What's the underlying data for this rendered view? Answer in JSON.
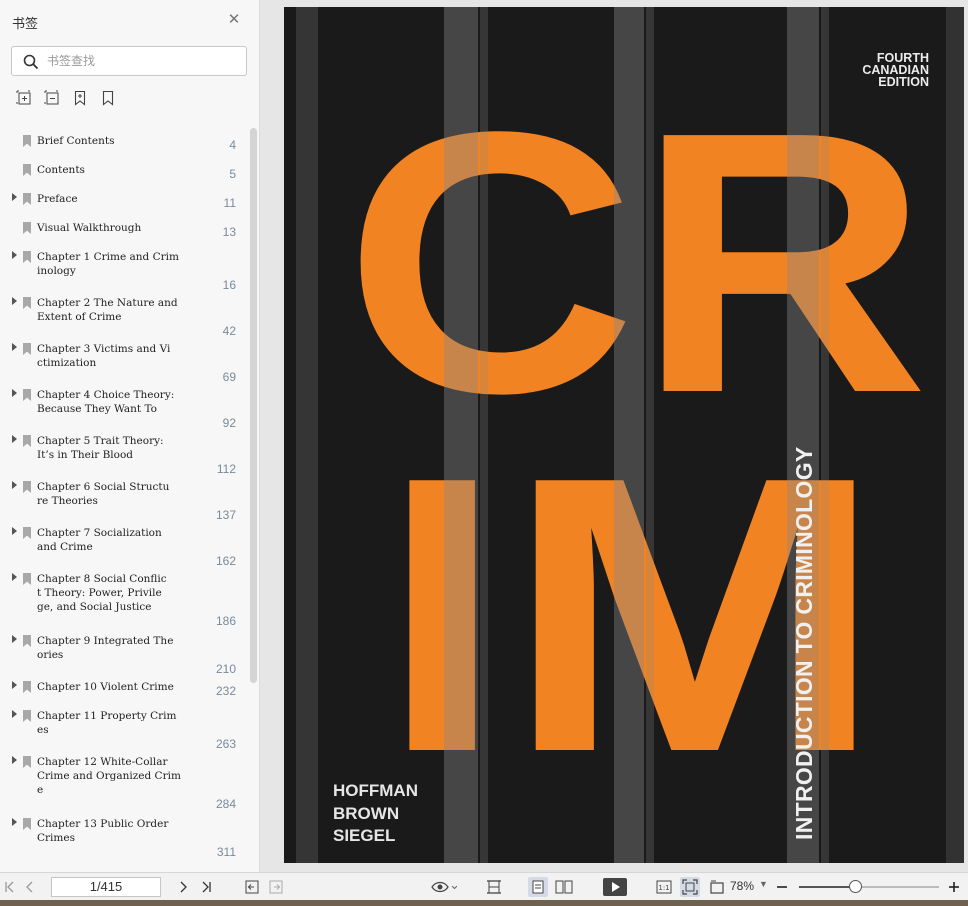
{
  "sidebar": {
    "title": "书签",
    "search_placeholder": "书签查找",
    "bookmarks": [
      {
        "label": "Brief Contents",
        "page": "4",
        "expandable": false
      },
      {
        "label": "Contents",
        "page": "5",
        "expandable": false
      },
      {
        "label": "Preface",
        "page": "11",
        "expandable": true
      },
      {
        "label": "Visual Walkthrough",
        "page": "13",
        "expandable": false
      },
      {
        "label": "Chapter 1 Crime and Crim\ninology",
        "page": "16",
        "expandable": true
      },
      {
        "label": "Chapter 2 The Nature and\nExtent of Crime",
        "page": "42",
        "expandable": true
      },
      {
        "label": "Chapter 3 Victims and Vi\nctimization",
        "page": "69",
        "expandable": true
      },
      {
        "label": "Chapter 4 Choice Theory:\nBecause They Want To",
        "page": "92",
        "expandable": true
      },
      {
        "label": "Chapter 5 Trait Theory:\nIt’s in Their Blood",
        "page": "112",
        "expandable": true
      },
      {
        "label": "Chapter 6 Social Structu\nre Theories",
        "page": "137",
        "expandable": true
      },
      {
        "label": "Chapter 7 Socialization\nand Crime",
        "page": "162",
        "expandable": true
      },
      {
        "label": "Chapter 8 Social Conflic\nt Theory: Power, Privile\nge, and Social Justice",
        "page": "186",
        "expandable": true
      },
      {
        "label": "Chapter 9 Integrated The\nories",
        "page": "210",
        "expandable": true
      },
      {
        "label": "Chapter 10 Violent Crime",
        "page": "232",
        "expandable": true
      },
      {
        "label": "Chapter 11 Property Crim\nes",
        "page": "263",
        "expandable": true
      },
      {
        "label": "Chapter 12 White-Collar\nCrime and Organized Crim\ne",
        "page": "284",
        "expandable": true
      },
      {
        "label": "Chapter 13 Public Order\nCrimes",
        "page": "311",
        "expandable": true
      }
    ]
  },
  "cover": {
    "big_text_top": "CR",
    "big_text_bottom": "IM",
    "edition_lines": [
      "FOURTH",
      "CANADIAN",
      "EDITION"
    ],
    "authors": [
      "HOFFMAN",
      "BROWN",
      "SIEGEL"
    ],
    "subtitle": "INTRODUCTION TO CRIMINOLOGY",
    "colors": {
      "background": "#1b1a1a",
      "accent": "#f28322"
    }
  },
  "toolbar": {
    "page_display": "1/415",
    "zoom": "78%",
    "zoom_level_fraction": 0.4
  }
}
